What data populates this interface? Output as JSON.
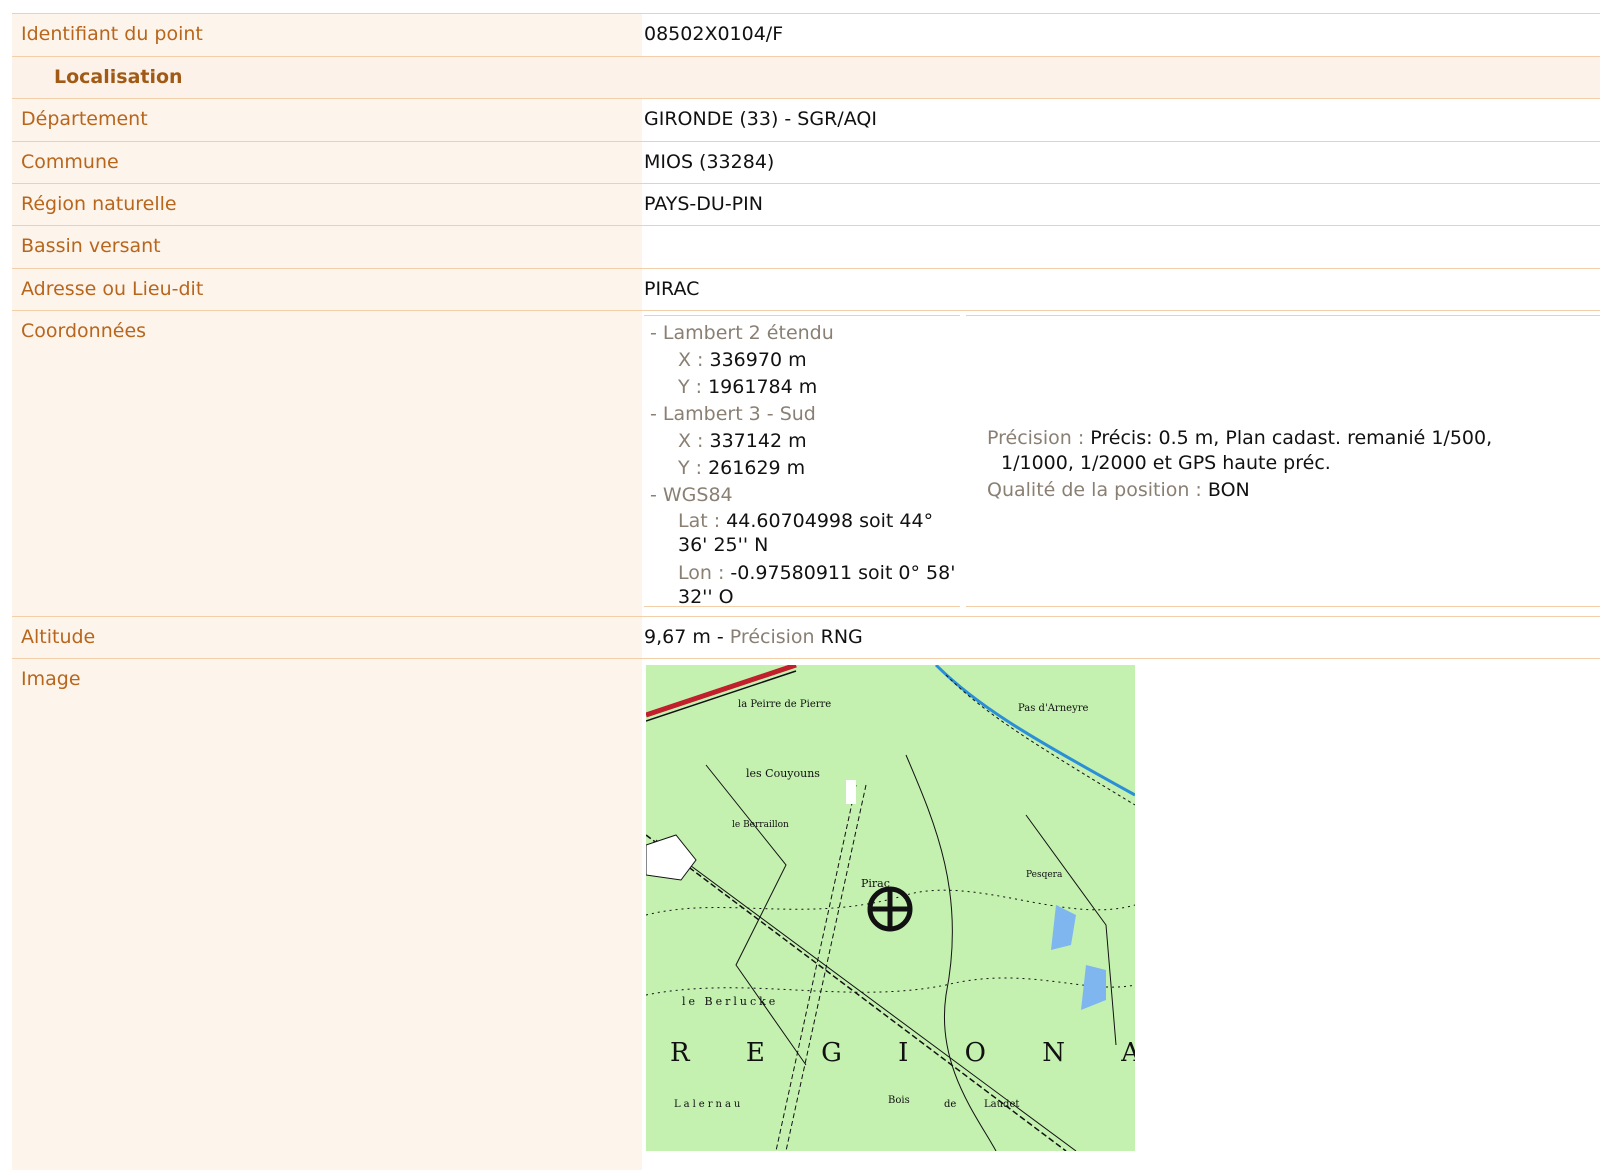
{
  "rows": {
    "identifiant": {
      "label": "Identifiant du point",
      "value": "08502X0104/F"
    },
    "localisation": {
      "label": "Localisation"
    },
    "departement": {
      "label": "Département",
      "value": "GIRONDE (33) - SGR/AQI"
    },
    "commune": {
      "label": "Commune",
      "value": "MIOS (33284)"
    },
    "region": {
      "label": "Région naturelle",
      "value": "PAYS-DU-PIN"
    },
    "bassin": {
      "label": "Bassin versant",
      "value": ""
    },
    "adresse": {
      "label": "Adresse ou Lieu-dit",
      "value": "PIRAC"
    },
    "coordonnees": {
      "label": "Coordonnées"
    },
    "altitude": {
      "label": "Altitude",
      "value": "9,67 m",
      "sep": " - ",
      "prec_label": "Précision",
      "prec_value": " RNG"
    },
    "image": {
      "label": "Image"
    }
  },
  "coords": {
    "lambert2": {
      "title": "- Lambert 2 étendu",
      "x_label": "X : ",
      "x_value": "336970 m",
      "y_label": "Y : ",
      "y_value": "1961784 m"
    },
    "lambert3": {
      "title": "- Lambert 3 - Sud",
      "x_label": "X : ",
      "x_value": "337142 m",
      "y_label": "Y : ",
      "y_value": "261629 m"
    },
    "wgs84": {
      "title": "- WGS84",
      "lat_label": "Lat : ",
      "lat_value": "44.60704998 soit 44° 36' 25'' N",
      "lon_label": "Lon : ",
      "lon_value": "-0.97580911 soit 0° 58' 32'' O"
    },
    "precision": {
      "label": "Précision : ",
      "value": "Précis: 0.5 m, Plan cadast. remanié 1/500, 1/1000, 1/2000 et GPS haute préc."
    },
    "qualite": {
      "label": "Qualité de la position : ",
      "value": "BON"
    }
  },
  "map": {
    "labels": {
      "peirre": "la Peirre de Pierre",
      "arneyre": "Pas d'Arneyre",
      "couyouns": "les Couyouns",
      "berraillon": "le Berraillon",
      "pirac": "Pirac",
      "pesqera": "Pesqera",
      "berlucke": "le Berlucke",
      "lalernau": "Lalernau",
      "bois": "Bois",
      "de": "de",
      "laudet": "Laudet",
      "regional": "R E G I O N A L"
    },
    "colors": {
      "land": "#c4f0b0",
      "road": "#c21e2c",
      "water": "#2a8fd6",
      "ink": "#111111"
    }
  }
}
